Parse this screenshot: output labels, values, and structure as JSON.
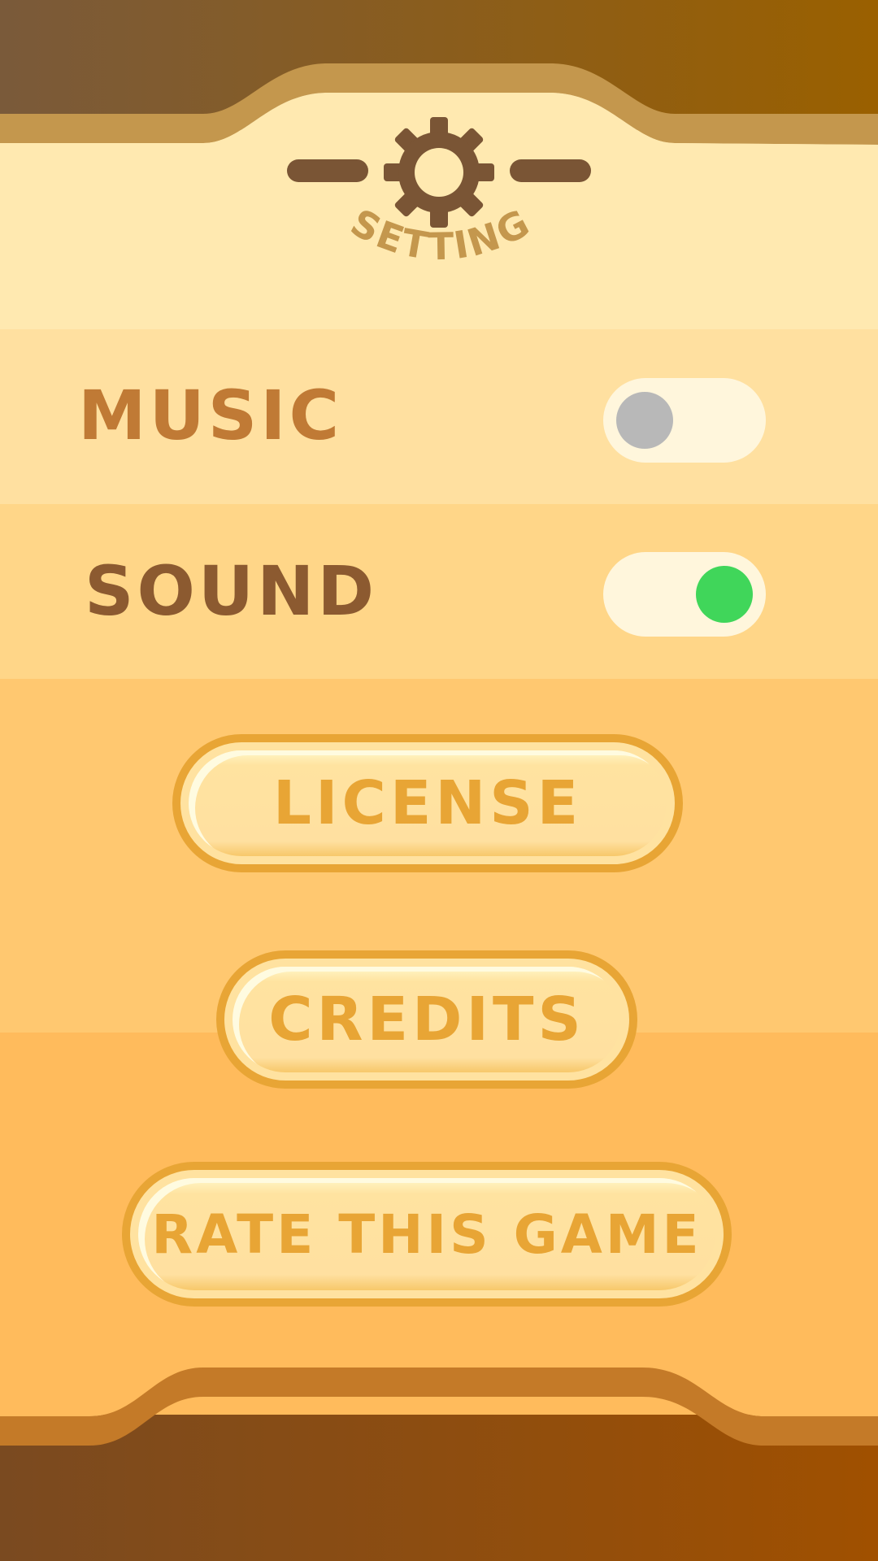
{
  "header": {
    "title": "SETTING",
    "icon": "gear-icon"
  },
  "settings": {
    "music": {
      "label": "MUSIC",
      "enabled": false
    },
    "sound": {
      "label": "SOUND",
      "enabled": true
    }
  },
  "buttons": {
    "license": "LICENSE",
    "credits": "CREDITS",
    "rate": "RATE THIS GAME"
  },
  "colors": {
    "toggle_on": "#40d65a",
    "toggle_off": "#b8b8b8",
    "button_accent": "#e8a535",
    "header_brown": "#7a5535"
  }
}
